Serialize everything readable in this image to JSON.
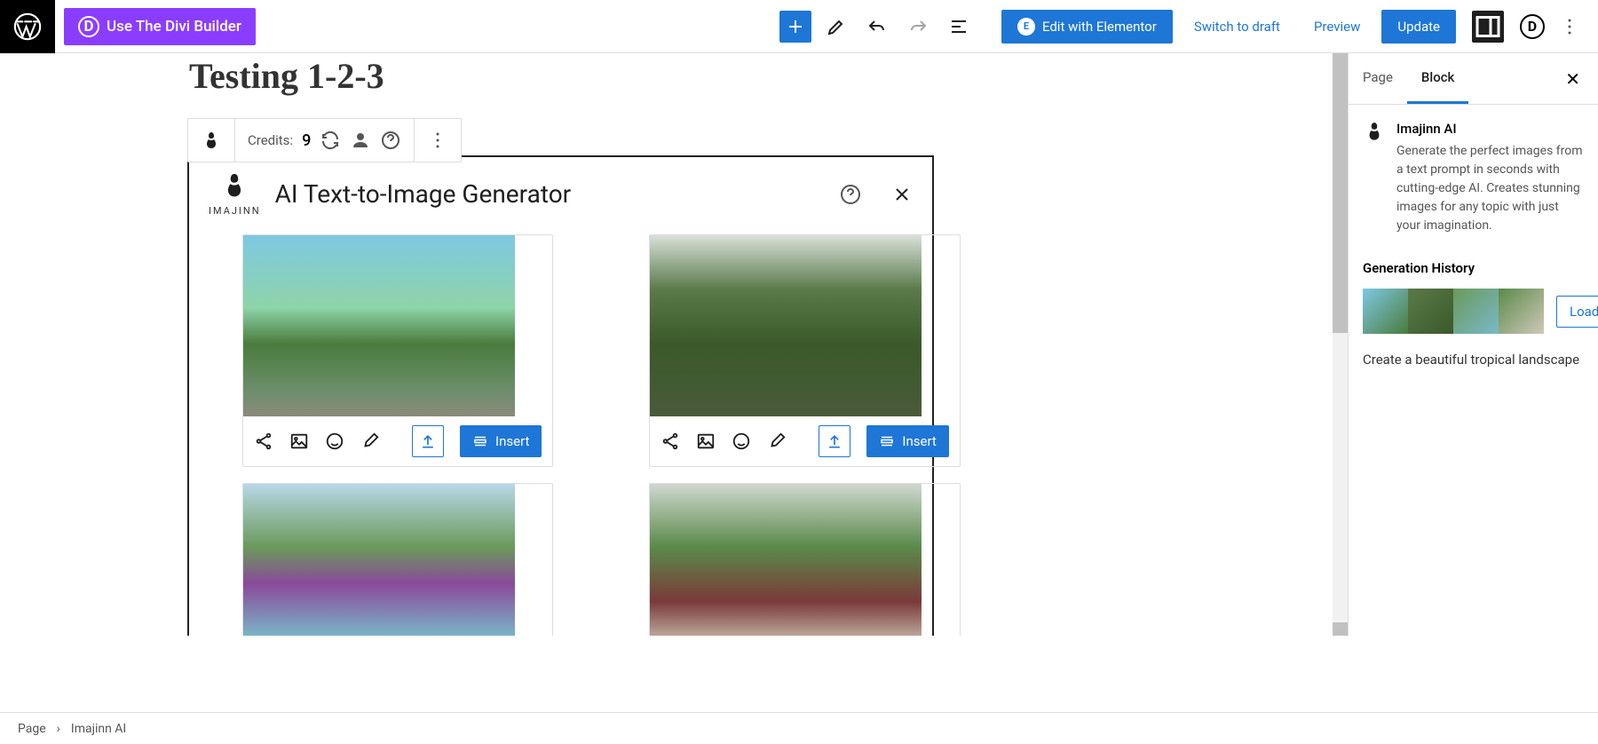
{
  "toolbar": {
    "divi_button": "Use The Divi Builder",
    "divi_d": "D",
    "elementor_button": "Edit with Elementor",
    "elementor_e": "E",
    "switch_draft": "Switch to draft",
    "preview": "Preview",
    "update": "Update"
  },
  "page": {
    "title": "Testing 1-2-3"
  },
  "block_toolbar": {
    "credits_label": "Credits:",
    "credits_value": "9"
  },
  "ai_panel": {
    "logo_text": "IMAJINN",
    "title": "AI Text-to-Image Generator",
    "insert_label": "Insert"
  },
  "sidebar": {
    "tabs": {
      "page": "Page",
      "block": "Block"
    },
    "block_name": "Imajinn AI",
    "block_desc": "Generate the perfect images from a text prompt in seconds with cutting-edge AI. Creates stunning images for any topic with just your imagination.",
    "history_title": "Generation History",
    "load_button": "Load",
    "prompt_text": "Create a beautiful tropical landscape"
  },
  "footer": {
    "breadcrumb_page": "Page",
    "breadcrumb_sep": "›",
    "breadcrumb_block": "Imajinn AI"
  }
}
